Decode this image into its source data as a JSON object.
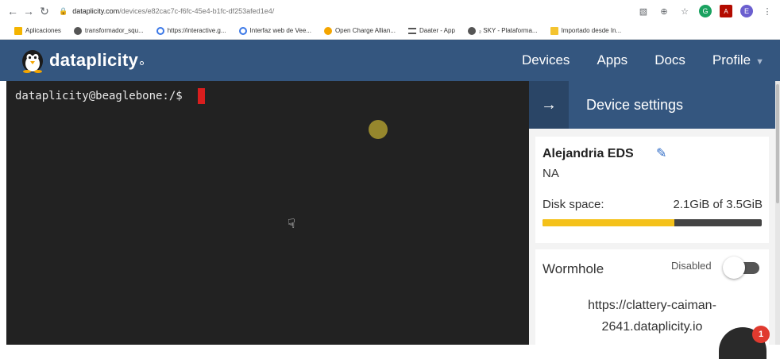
{
  "browser": {
    "url_host": "dataplicity.com",
    "url_path": "/devices/e82cac7c-f6fc-45e4-b1fc-df253afed1e4/",
    "bookmarks": [
      {
        "label": "Aplicaciones",
        "icon": "apps-grid-icon",
        "color": "#f4b400"
      },
      {
        "label": "transformador_squ...",
        "icon": "globe-icon",
        "color": "#555555"
      },
      {
        "label": "https://interactive.g...",
        "icon": "circle-logo-icon",
        "color": "#3b78e7"
      },
      {
        "label": "Interfaz web de Vee...",
        "icon": "circle-logo-icon",
        "color": "#3b78e7"
      },
      {
        "label": "Open Charge Allian...",
        "icon": "charge-icon",
        "color": "#f4a500"
      },
      {
        "label": "Daater - App",
        "icon": "menu-lines-icon",
        "color": "#555555"
      },
      {
        "label": "₂ SKY - Plataforma...",
        "icon": "globe-icon",
        "color": "#555555"
      },
      {
        "label": "Importado desde In...",
        "icon": "folder-icon",
        "color": "#f4c430"
      }
    ],
    "avatar_letter": "E"
  },
  "nav": {
    "brand": "dataplicity",
    "items": [
      "Devices",
      "Apps",
      "Docs",
      "Profile"
    ]
  },
  "terminal": {
    "prompt": "dataplicity@beaglebone:/$"
  },
  "panel": {
    "title": "Device settings",
    "device_name": "Alejandria EDS",
    "device_sub": "NA",
    "disk_label": "Disk space:",
    "disk_value": "2.1GiB of 3.5GiB",
    "disk_fraction": 0.6,
    "wormhole_label": "Wormhole",
    "wormhole_status": "Disabled",
    "wormhole_url_line1": "https://clattery-caiman-",
    "wormhole_url_line2": "2641.dataplicity.io"
  },
  "chat": {
    "badge": "1"
  },
  "colors": {
    "nav_bg": "#34567f",
    "terminal_bg": "#222222",
    "cursor": "#d91e1e",
    "disk_fill": "#f4c11a"
  }
}
